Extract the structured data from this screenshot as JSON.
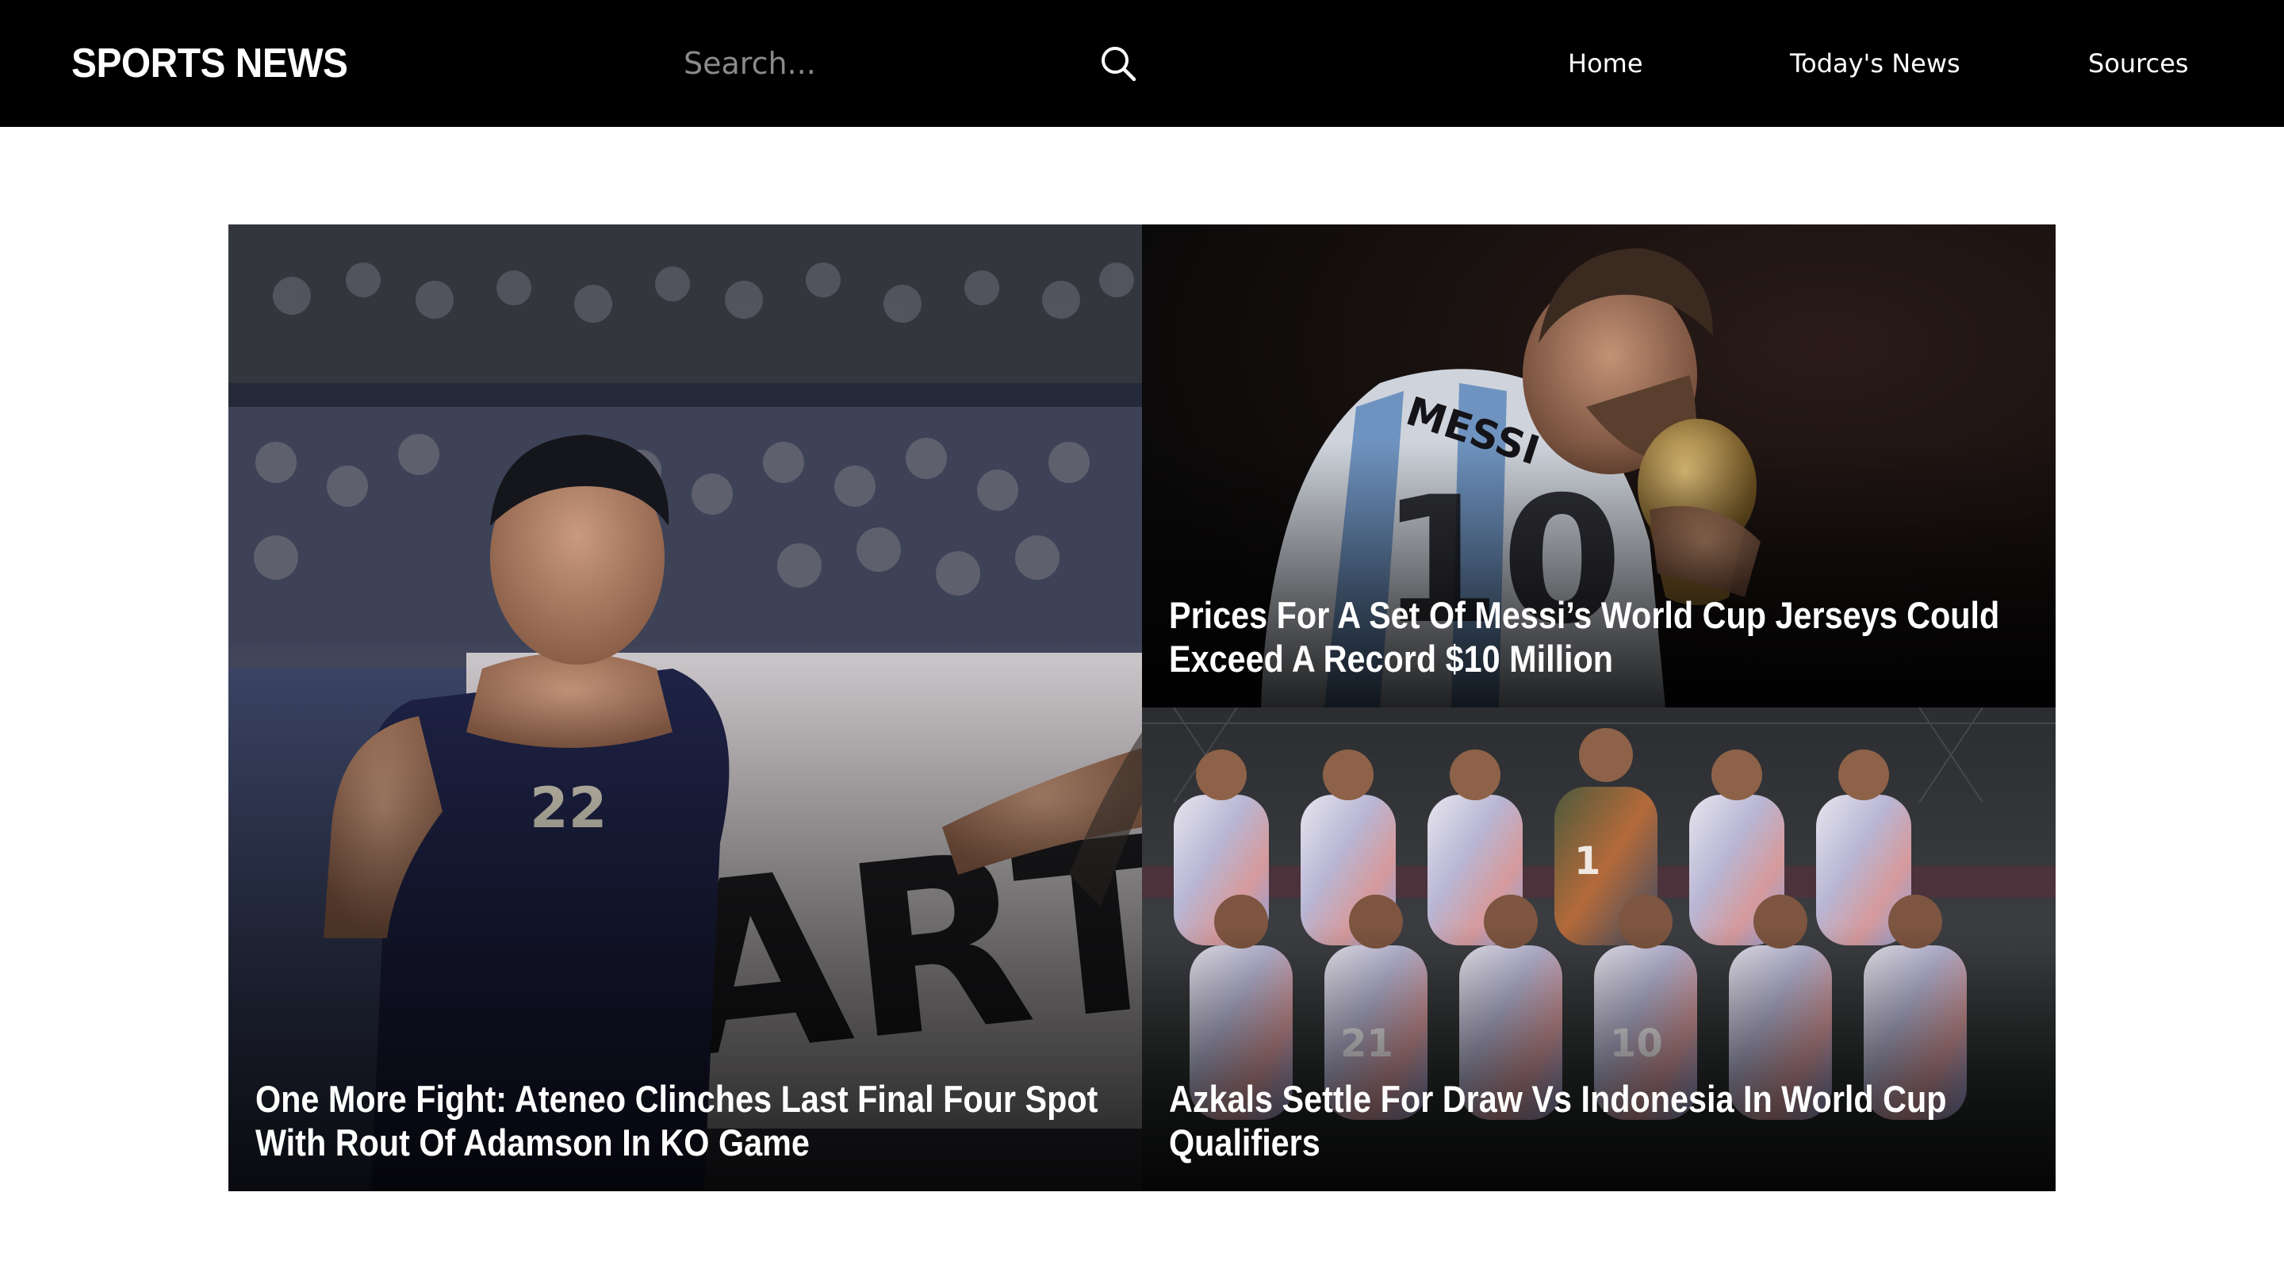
{
  "header": {
    "brand": "SPORTS NEWS",
    "search_placeholder": "Search...",
    "search_icon": "search-icon",
    "nav": [
      {
        "label": "Home"
      },
      {
        "label": "Today's News"
      },
      {
        "label": "Sources"
      }
    ]
  },
  "featured": {
    "main": {
      "headline": "One More Fight: Ateneo Clinches Last Final Four Spot With Rout Of Adamson In KO Game",
      "image": "basketball-player-photo"
    },
    "top_right": {
      "headline": "Prices For A Set Of Messi’s World Cup Jerseys Could Exceed A Record $10 Million",
      "image": "messi-kissing-trophy-photo",
      "jersey_text": "MESSI"
    },
    "bottom_right": {
      "headline": "Azkals Settle For Draw Vs Indonesia In World Cup Qualifiers",
      "image": "football-team-photo"
    }
  },
  "colors": {
    "header_bg": "#000000",
    "header_text": "#ffffff",
    "placeholder": "#8a8a8a",
    "page_bg": "#ffffff"
  }
}
